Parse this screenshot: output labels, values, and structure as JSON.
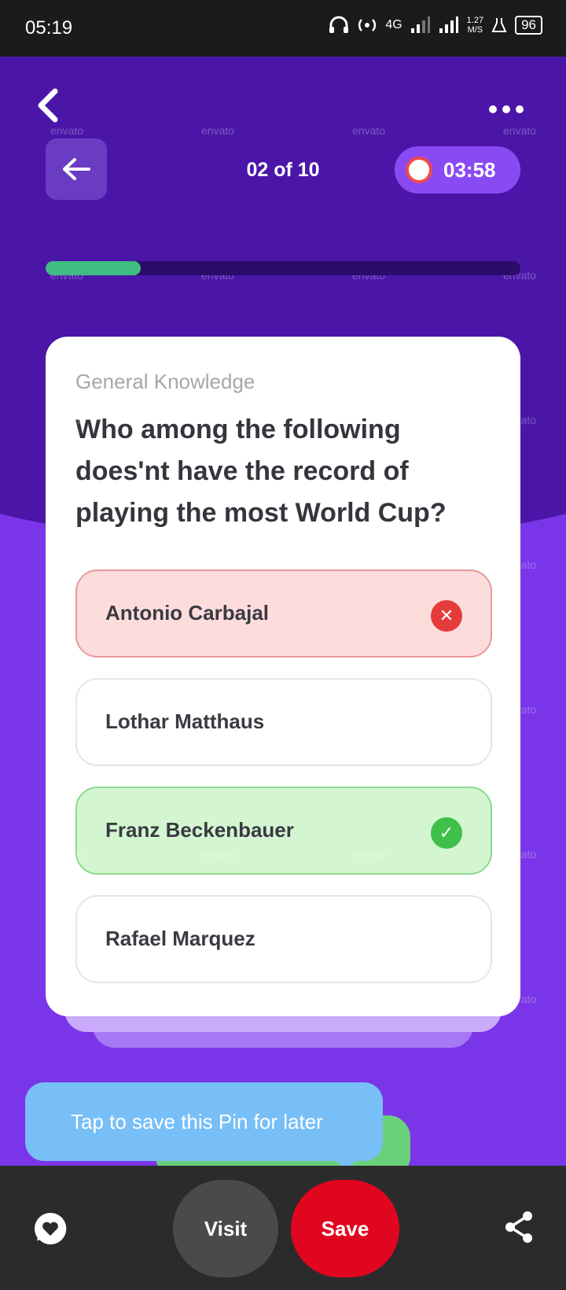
{
  "status_bar": {
    "time": "05:19",
    "network": "4G",
    "speed_top": "1.27",
    "speed_bottom": "M/S",
    "battery": "96"
  },
  "quiz": {
    "counter": "02 of 10",
    "timer": "03:58",
    "progress": 0.2,
    "category": "General Knowledge",
    "question": "Who among the following does'nt have the record of playing the most World Cup?",
    "options": [
      {
        "label": "Antonio Carbajal",
        "state": "wrong"
      },
      {
        "label": "Lothar Matthaus",
        "state": "neutral"
      },
      {
        "label": "Franz Beckenbauer",
        "state": "correct"
      },
      {
        "label": "Rafael Marquez",
        "state": "neutral"
      }
    ],
    "watermark": "envato"
  },
  "toast": {
    "text": "Tap to save this Pin for later"
  },
  "bottom_bar": {
    "visit_label": "Visit",
    "save_label": "Save"
  },
  "colors": {
    "primary_purple": "#7b35e8",
    "dark_purple": "#4b16a8",
    "progress_green": "#3fbd83",
    "save_red": "#e1061f",
    "toast_blue": "#78bff7"
  }
}
